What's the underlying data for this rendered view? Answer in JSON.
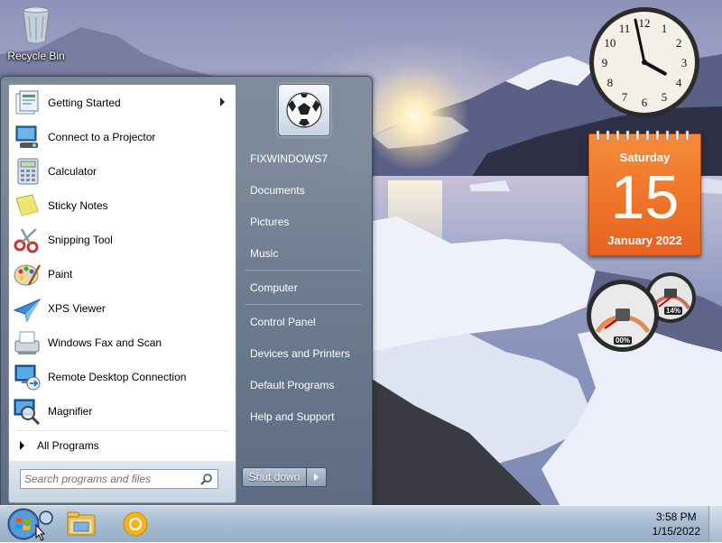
{
  "desktop": {
    "icons": [
      {
        "label": "Recycle Bin"
      }
    ]
  },
  "gadgets": {
    "clock": {
      "hour": 3,
      "minute": 58
    },
    "calendar": {
      "weekday": "Saturday",
      "day": "15",
      "month_year": "January 2022"
    },
    "cpu_meter": {
      "cpu": "00%",
      "memory": "14%"
    }
  },
  "start_menu": {
    "programs": [
      {
        "label": "Getting Started",
        "icon": "getting-started-icon",
        "submenu": true
      },
      {
        "label": "Connect to a Projector",
        "icon": "projector-icon"
      },
      {
        "label": "Calculator",
        "icon": "calculator-icon"
      },
      {
        "label": "Sticky Notes",
        "icon": "sticky-notes-icon"
      },
      {
        "label": "Snipping Tool",
        "icon": "scissors-icon"
      },
      {
        "label": "Paint",
        "icon": "palette-icon"
      },
      {
        "label": "XPS Viewer",
        "icon": "xps-viewer-icon"
      },
      {
        "label": "Windows Fax and Scan",
        "icon": "fax-icon"
      },
      {
        "label": "Remote Desktop Connection",
        "icon": "remote-desktop-icon"
      },
      {
        "label": "Magnifier",
        "icon": "magnifier-icon"
      }
    ],
    "all_programs": "All Programs",
    "search_placeholder": "Search programs and files",
    "right_items": [
      "FIXWINDOWS7",
      "Documents",
      "Pictures",
      "Music",
      "Computer",
      "Control Panel",
      "Devices and Printers",
      "Default Programs",
      "Help and Support"
    ],
    "shutdown_label": "Shut down"
  },
  "taskbar": {
    "pinned": [
      "windows-explorer-icon",
      "chrome-icon"
    ],
    "time": "3:58 PM",
    "date": "1/15/2022"
  }
}
